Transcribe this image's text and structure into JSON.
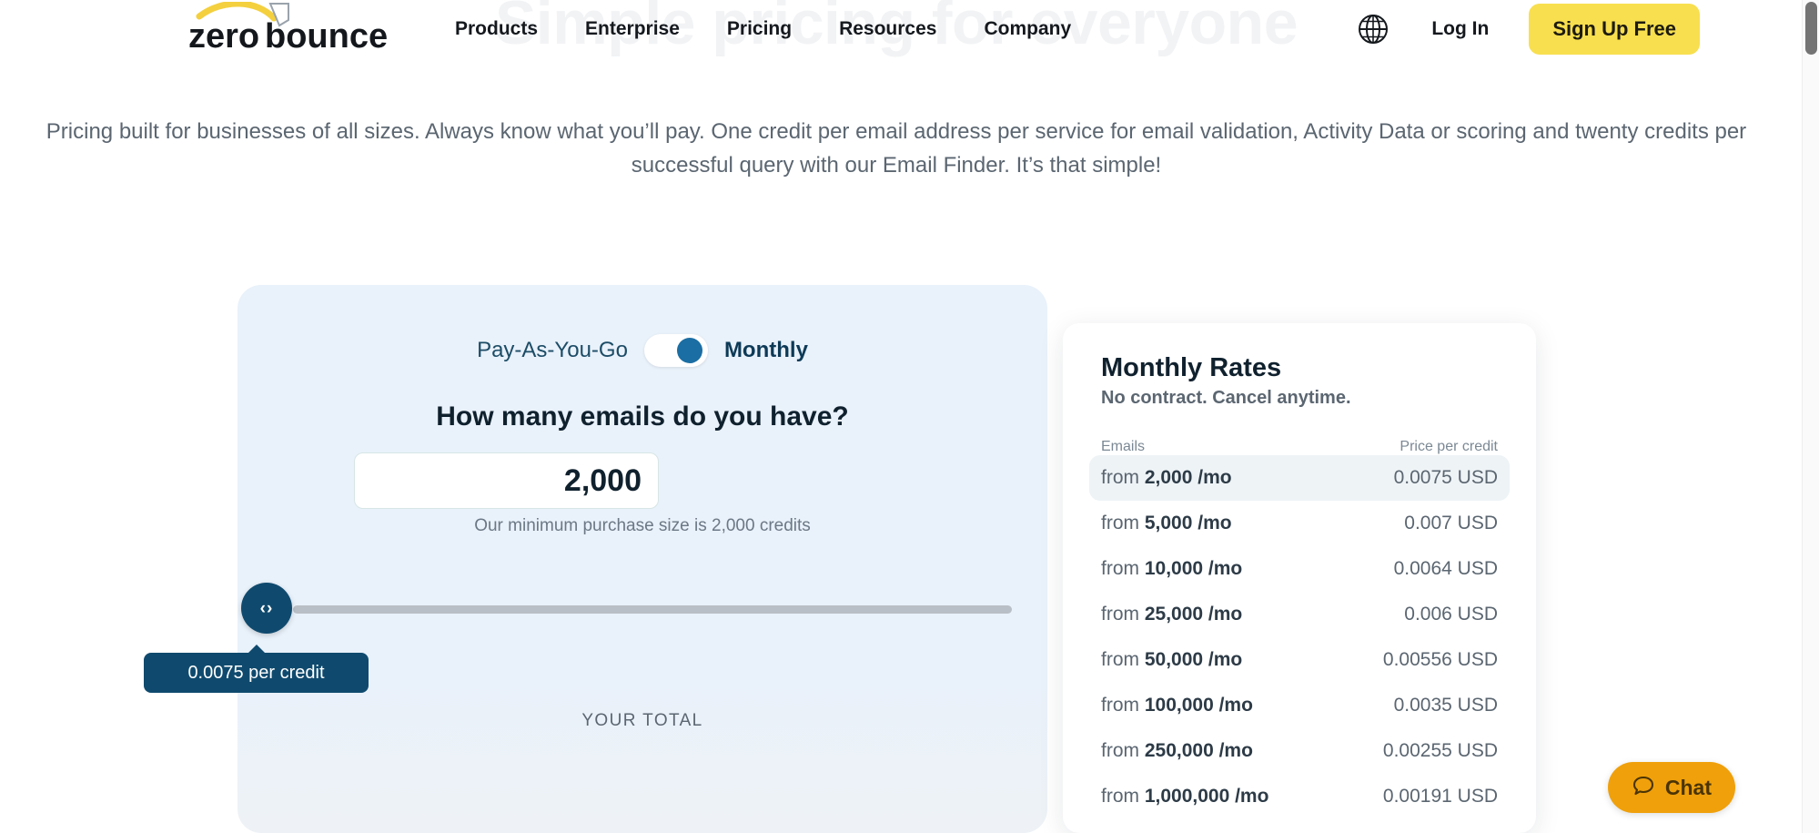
{
  "brand": {
    "name": "zero bounce",
    "accent_yellow": "#f8df4f",
    "accent_navy": "#0f4a6e",
    "accent_blue": "#1b6ea3",
    "chat_orange": "#efa00b"
  },
  "ghost_heading": "Simple pricing for everyone",
  "nav": {
    "items": [
      {
        "label": "Products",
        "name": "nav-link-products"
      },
      {
        "label": "Enterprise",
        "name": "nav-link-enterprise"
      },
      {
        "label": "Pricing",
        "name": "nav-link-pricing"
      },
      {
        "label": "Resources",
        "name": "nav-link-resources"
      },
      {
        "label": "Company",
        "name": "nav-link-company"
      }
    ],
    "language_icon": "globe-icon",
    "login_label": "Log In",
    "signup_label": "Sign Up Free"
  },
  "subtitle": "Pricing built for businesses of all sizes. Always know what you’ll pay. One credit per email address per service for email validation, Activity Data or scoring and twenty credits per successful query with our Email Finder. It’s that simple!",
  "calculator": {
    "toggle": {
      "left_label": "Pay-As-You-Go",
      "right_label": "Monthly",
      "selected": "Monthly"
    },
    "question": "How many emails do you have?",
    "email_count_value": "2,000",
    "email_count_placeholder": "2,000",
    "minimum_note": "Our minimum purchase size is 2,000 credits",
    "slider": {
      "handle_icon": "resize-horizontal-icon",
      "handle_glyph": "‹›",
      "tooltip": "0.0075 per credit",
      "position_percent": 0
    },
    "total_label": "YOUR TOTAL"
  },
  "rates": {
    "title": "Monthly Rates",
    "subtitle": "No contract. Cancel anytime.",
    "col_emails": "Emails",
    "col_price": "Price per credit",
    "rows": [
      {
        "from": "from",
        "emails": "2,000",
        "unit": "/mo",
        "price": "0.0075 USD",
        "highlight": true
      },
      {
        "from": "from",
        "emails": "5,000",
        "unit": "/mo",
        "price": "0.007 USD",
        "highlight": false
      },
      {
        "from": "from",
        "emails": "10,000",
        "unit": "/mo",
        "price": "0.0064 USD",
        "highlight": false
      },
      {
        "from": "from",
        "emails": "25,000",
        "unit": "/mo",
        "price": "0.006 USD",
        "highlight": false
      },
      {
        "from": "from",
        "emails": "50,000",
        "unit": "/mo",
        "price": "0.00556 USD",
        "highlight": false
      },
      {
        "from": "from",
        "emails": "100,000",
        "unit": "/mo",
        "price": "0.0035 USD",
        "highlight": false
      },
      {
        "from": "from",
        "emails": "250,000",
        "unit": "/mo",
        "price": "0.00255 USD",
        "highlight": false
      },
      {
        "from": "from",
        "emails": "1,000,000",
        "unit": "/mo",
        "price": "0.00191 USD",
        "highlight": false
      }
    ]
  },
  "chat": {
    "label": "Chat",
    "icon": "chat-bubble-icon"
  }
}
